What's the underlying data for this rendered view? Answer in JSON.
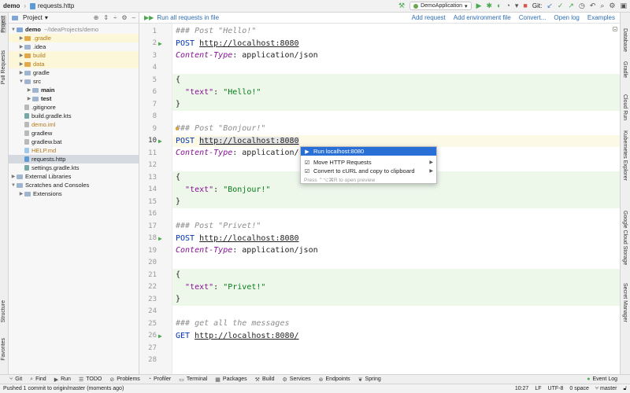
{
  "navbar": {
    "project": "demo",
    "file": "requests.http",
    "run_config": "DemoApplication",
    "git_label": "Git:"
  },
  "left_strip": {
    "project": "Project",
    "pull_requests": "Pull Requests",
    "structure": "Structure",
    "favorites": "Favorites"
  },
  "right_strip": {
    "database": "Database",
    "gradle": "Gradle",
    "cloud_run": "Cloud Run",
    "kubernetes": "Kubernetes Explorer",
    "gcs": "Google Cloud Storage",
    "secret": "Secret Manager"
  },
  "project_panel": {
    "title": "Project",
    "root": {
      "name": "demo",
      "path": "~/IdeaProjects/demo"
    },
    "items": {
      "gradle_dir": ".gradle",
      "idea": ".idea",
      "build": "build",
      "data": "data",
      "gradle": "gradle",
      "src": "src",
      "main": "main",
      "test": "test",
      "gitignore": ".gitignore",
      "build_gradle": "build.gradle.kts",
      "demo_iml": "demo.iml",
      "gradlew": "gradlew",
      "gradlew_bat": "gradlew.bat",
      "help": "HELP.md",
      "requests": "requests.http",
      "settings": "settings.gradle.kts",
      "ext_libs": "External Libraries",
      "scratches": "Scratches and Consoles",
      "extensions": "Extensions"
    }
  },
  "editor_toolbar": {
    "run_all": "Run all requests in file",
    "add_request": "Add request",
    "add_env": "Add environment file",
    "convert": "Convert...",
    "open_log": "Open log",
    "examples": "Examples"
  },
  "code": {
    "l1": "### Post \"Hello!\"",
    "l2_method": "POST",
    "l2_url": "http://localhost:8080",
    "l3_header": "Content-Type",
    "l3_value": ": application/json",
    "l5": "{",
    "l6_key": "\"text\"",
    "l6_val": "\"Hello!\"",
    "l7": "}",
    "l9": "### Post \"Bonjour!\"",
    "l10_method": "POST",
    "l10_url": "http://localhost:8080",
    "l11_header": "Content-Type",
    "l11_value": ": application/",
    "l13": "{",
    "l14_key": "\"text\"",
    "l14_val": "\"Bonjour!\"",
    "l15": "}",
    "l17": "### Post \"Privet!\"",
    "l18_method": "POST",
    "l18_url": "http://localhost:8080",
    "l19_header": "Content-Type",
    "l19_value": ": application/json",
    "l21": "{",
    "l22_key": "\"text\"",
    "l22_val": "\"Privet!\"",
    "l23": "}",
    "l25": "### get all the messages",
    "l26_method": "GET",
    "l26_url": "http://localhost:8080/"
  },
  "line_numbers": [
    "1",
    "2",
    "3",
    "4",
    "5",
    "6",
    "7",
    "8",
    "9",
    "10",
    "11",
    "12",
    "13",
    "14",
    "15",
    "16",
    "17",
    "18",
    "19",
    "20",
    "21",
    "22",
    "23",
    "24",
    "25",
    "26",
    "27",
    "28"
  ],
  "popup": {
    "run": "Run localhost:8080",
    "move": "Move HTTP Requests",
    "convert": "Convert to cURL and copy to clipboard",
    "hint": "Press ⌃⌥⌘R to open preview"
  },
  "bottom_tools": {
    "git": "Git",
    "find": "Find",
    "run": "Run",
    "todo": "TODO",
    "problems": "Problems",
    "profiler": "Profiler",
    "terminal": "Terminal",
    "packages": "Packages",
    "build": "Build",
    "services": "Services",
    "endpoints": "Endpoints",
    "spring": "Spring",
    "event_log": "Event Log"
  },
  "status": {
    "message": "Pushed 1 commit to origin/master (moments ago)",
    "position": "10:27",
    "line_sep": "LF",
    "encoding": "UTF-8",
    "indent": "0 space",
    "branch": "master"
  }
}
